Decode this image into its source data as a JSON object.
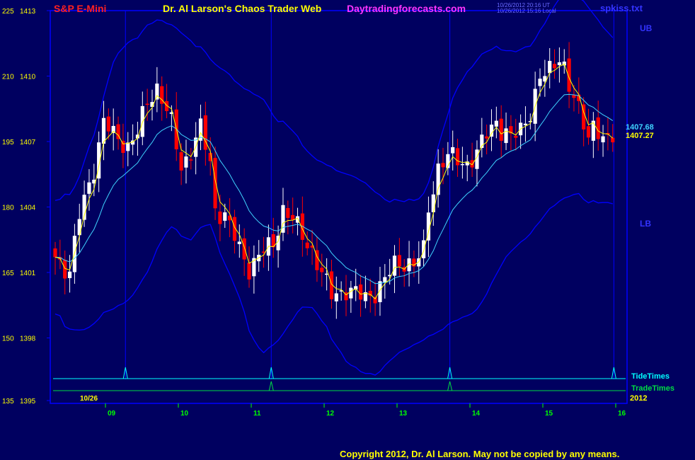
{
  "header": {
    "symbol": "S&P E-Mini",
    "title": "Dr. Al Larson's Chaos Trader Web",
    "site": "Daytradingforecasts.com",
    "timestamp_ut": "10/26/2012 20:16 UT",
    "timestamp_local": "10/26/2012 15:16 Local",
    "file": "spkiss.txt"
  },
  "footer": {
    "copyright": "Copyright 2012, Dr. Al Larson. May not be copied by any means."
  },
  "colors": {
    "background": "#000060",
    "frame": "#0000ff",
    "up_candle": "#ffffff",
    "down_candle": "#ff0000",
    "bands": "#0000ff",
    "slow_ma": "#3fd3ff",
    "fast_ma": "#ffff00",
    "tide_times": "#00ffff",
    "trade_times": "#00dd44",
    "symbol_text": "#ff2020",
    "title_text": "#ffff00",
    "site_text": "#ff33ff",
    "y_labels": "#ffff00",
    "day_labels": "#00ff00",
    "band_labels": "#3333ff"
  },
  "chart_data": {
    "type": "candlestick",
    "y_axis": {
      "left_labels": [
        "225",
        "210",
        "195",
        "180",
        "165",
        "150",
        "135"
      ],
      "price_labels": [
        "1413",
        "1410",
        "1407",
        "1404",
        "1401",
        "1398",
        "1395"
      ],
      "price_min": 1395,
      "price_max": 1413
    },
    "x_axis": {
      "start_label": "10/26",
      "day_labels": [
        "09",
        "10",
        "11",
        "12",
        "13",
        "14",
        "15",
        "16"
      ],
      "year_label": "2012"
    },
    "band_labels": {
      "upper": "UB",
      "lower": "LB"
    },
    "last_values": {
      "slow_ma": "1407.68",
      "fast_ma": "1407.27"
    },
    "legend": {
      "tide": "TideTimes",
      "trade": "TradeTimes"
    },
    "tide_times_at": [
      "08:45",
      "10:45",
      "13:12",
      "15:27"
    ],
    "trade_times_at": [
      "10:45",
      "13:12"
    ],
    "price_path": [
      [
        0,
        1401.7
      ],
      [
        3,
        1401.0
      ],
      [
        5,
        1403.6
      ],
      [
        8,
        1405.8
      ],
      [
        10,
        1407.9
      ],
      [
        12,
        1407.3
      ],
      [
        15,
        1406.8
      ],
      [
        17,
        1407.4
      ],
      [
        19,
        1408.8
      ],
      [
        21,
        1409.5
      ],
      [
        22,
        1409.0
      ],
      [
        24,
        1407.8
      ],
      [
        26,
        1405.8
      ],
      [
        28,
        1406.6
      ],
      [
        30,
        1407.6
      ],
      [
        32,
        1406.0
      ],
      [
        33,
        1403.9
      ],
      [
        35,
        1403.6
      ],
      [
        38,
        1402.1
      ],
      [
        40,
        1401.2
      ],
      [
        43,
        1402.0
      ],
      [
        45,
        1402.3
      ],
      [
        47,
        1403.9
      ],
      [
        49,
        1403.4
      ],
      [
        51,
        1402.7
      ],
      [
        53,
        1402.0
      ],
      [
        55,
        1400.9
      ],
      [
        57,
        1400.0
      ],
      [
        60,
        1400.2
      ],
      [
        62,
        1400.0
      ],
      [
        64,
        1399.9
      ],
      [
        66,
        1400.1
      ],
      [
        68,
        1400.6
      ],
      [
        70,
        1401.4
      ],
      [
        72,
        1401.5
      ],
      [
        74,
        1401.3
      ],
      [
        76,
        1402.0
      ],
      [
        77,
        1404.0
      ],
      [
        79,
        1405.8
      ],
      [
        81,
        1406.3
      ],
      [
        83,
        1406.2
      ],
      [
        85,
        1406.0
      ],
      [
        87,
        1406.4
      ],
      [
        89,
        1407.4
      ],
      [
        91,
        1408.0
      ],
      [
        92,
        1407.5
      ],
      [
        94,
        1407.1
      ],
      [
        96,
        1407.6
      ],
      [
        98,
        1408.4
      ],
      [
        100,
        1409.8
      ],
      [
        102,
        1410.3
      ],
      [
        104,
        1411.0
      ],
      [
        105,
        1410.4
      ],
      [
        106,
        1409.4
      ],
      [
        108,
        1408.4
      ],
      [
        110,
        1407.4
      ],
      [
        111,
        1407.8
      ],
      [
        113,
        1407.0
      ],
      [
        114,
        1406.9
      ],
      [
        115,
        1407.3
      ]
    ]
  }
}
